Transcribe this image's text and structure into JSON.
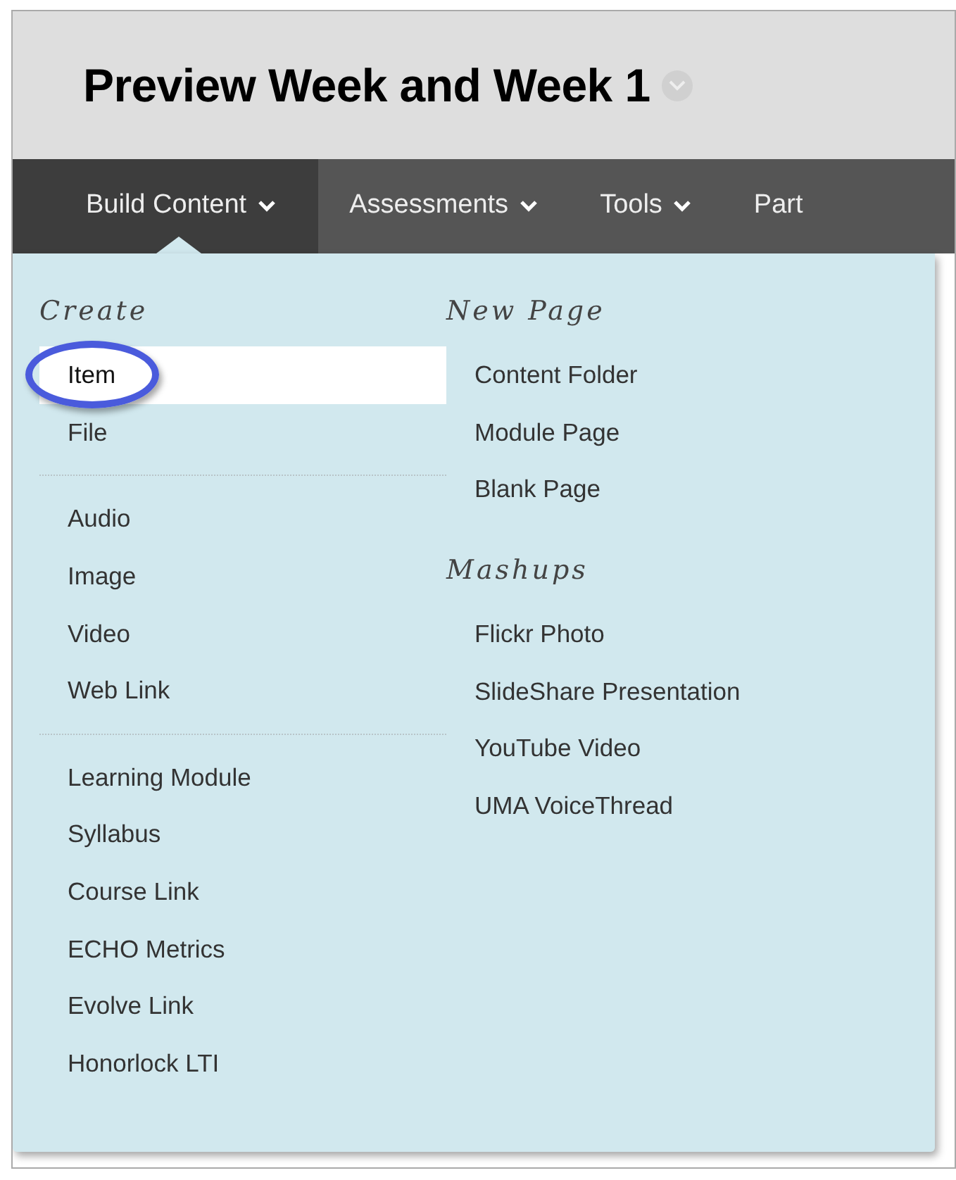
{
  "page_title": "Preview Week and Week 1",
  "nav": [
    {
      "label": "Build Content",
      "selected": true,
      "caret": true
    },
    {
      "label": "Assessments",
      "selected": false,
      "caret": true
    },
    {
      "label": "Tools",
      "selected": false,
      "caret": true
    },
    {
      "label": "Part",
      "selected": false,
      "caret": false
    }
  ],
  "menu": {
    "columns": [
      {
        "sections": [
          {
            "heading": "Create",
            "groups": [
              [
                {
                  "label": "Item",
                  "selected": true,
                  "circled": true
                },
                {
                  "label": "File",
                  "selected": false,
                  "circled": false
                }
              ],
              [
                {
                  "label": "Audio",
                  "selected": false,
                  "circled": false
                },
                {
                  "label": "Image",
                  "selected": false,
                  "circled": false
                },
                {
                  "label": "Video",
                  "selected": false,
                  "circled": false
                },
                {
                  "label": "Web Link",
                  "selected": false,
                  "circled": false
                }
              ],
              [
                {
                  "label": "Learning Module",
                  "selected": false,
                  "circled": false
                },
                {
                  "label": "Syllabus",
                  "selected": false,
                  "circled": false
                },
                {
                  "label": "Course Link",
                  "selected": false,
                  "circled": false
                },
                {
                  "label": "ECHO Metrics",
                  "selected": false,
                  "circled": false
                },
                {
                  "label": "Evolve Link",
                  "selected": false,
                  "circled": false
                },
                {
                  "label": "Honorlock LTI",
                  "selected": false,
                  "circled": false
                }
              ]
            ]
          }
        ]
      },
      {
        "sections": [
          {
            "heading": "New Page",
            "groups": [
              [
                {
                  "label": "Content Folder",
                  "selected": false,
                  "circled": false
                },
                {
                  "label": "Module Page",
                  "selected": false,
                  "circled": false
                },
                {
                  "label": "Blank Page",
                  "selected": false,
                  "circled": false
                }
              ]
            ]
          },
          {
            "heading": "Mashups",
            "groups": [
              [
                {
                  "label": "Flickr Photo",
                  "selected": false,
                  "circled": false
                },
                {
                  "label": "SlideShare Presentation",
                  "selected": false,
                  "circled": false
                },
                {
                  "label": "YouTube Video",
                  "selected": false,
                  "circled": false
                },
                {
                  "label": "UMA VoiceThread",
                  "selected": false,
                  "circled": false
                }
              ]
            ]
          }
        ]
      }
    ]
  }
}
